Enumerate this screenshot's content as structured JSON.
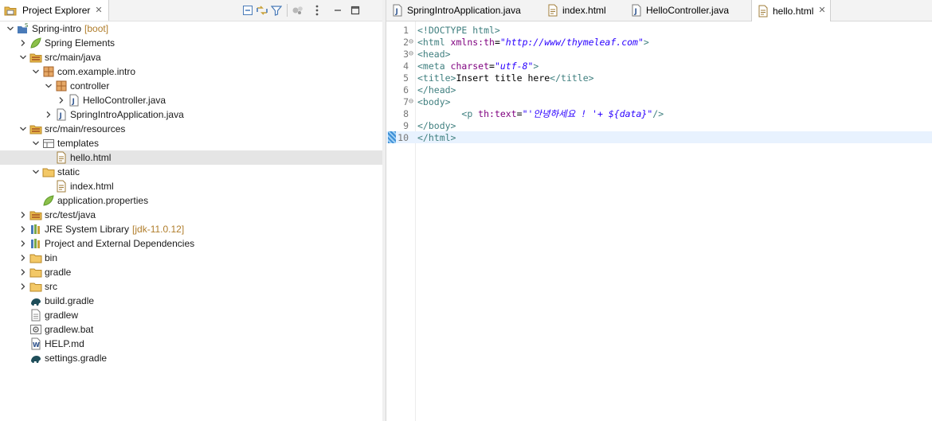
{
  "explorer": {
    "title": "Project Explorer",
    "tree": [
      {
        "label": "Spring-intro",
        "deco": "[boot]",
        "depth": 0,
        "twisty": "open",
        "icon": "boot-project-icon"
      },
      {
        "label": "Spring Elements",
        "depth": 1,
        "twisty": "closed",
        "icon": "spring-leaf-icon"
      },
      {
        "label": "src/main/java",
        "depth": 1,
        "twisty": "open",
        "icon": "source-folder-icon"
      },
      {
        "label": "com.example.intro",
        "depth": 2,
        "twisty": "open",
        "icon": "package-icon"
      },
      {
        "label": "controller",
        "depth": 3,
        "twisty": "open",
        "icon": "package-icon"
      },
      {
        "label": "HelloController.java",
        "depth": 4,
        "twisty": "closed",
        "icon": "java-file-icon"
      },
      {
        "label": "SpringIntroApplication.java",
        "depth": 3,
        "twisty": "closed",
        "icon": "java-file-icon"
      },
      {
        "label": "src/main/resources",
        "depth": 1,
        "twisty": "open",
        "icon": "source-folder-icon"
      },
      {
        "label": "templates",
        "depth": 2,
        "twisty": "open",
        "icon": "templates-folder-icon"
      },
      {
        "label": "hello.html",
        "depth": 3,
        "twisty": "none",
        "icon": "html-file-icon",
        "selected": true
      },
      {
        "label": "static",
        "depth": 2,
        "twisty": "open",
        "icon": "folder-icon"
      },
      {
        "label": "index.html",
        "depth": 3,
        "twisty": "none",
        "icon": "html-file-icon"
      },
      {
        "label": "application.properties",
        "depth": 2,
        "twisty": "none",
        "icon": "spring-leaf-icon"
      },
      {
        "label": "src/test/java",
        "depth": 1,
        "twisty": "closed",
        "icon": "source-folder-icon"
      },
      {
        "label": "JRE System Library",
        "deco": "[jdk-11.0.12]",
        "depth": 1,
        "twisty": "closed",
        "icon": "library-icon"
      },
      {
        "label": "Project and External Dependencies",
        "depth": 1,
        "twisty": "closed",
        "icon": "library-icon"
      },
      {
        "label": "bin",
        "depth": 1,
        "twisty": "closed",
        "icon": "folder-icon"
      },
      {
        "label": "gradle",
        "depth": 1,
        "twisty": "closed",
        "icon": "folder-icon"
      },
      {
        "label": "src",
        "depth": 1,
        "twisty": "closed",
        "icon": "folder-icon"
      },
      {
        "label": "build.gradle",
        "depth": 1,
        "twisty": "none",
        "icon": "gradle-icon"
      },
      {
        "label": "gradlew",
        "depth": 1,
        "twisty": "none",
        "icon": "text-file-icon"
      },
      {
        "label": "gradlew.bat",
        "depth": 1,
        "twisty": "none",
        "icon": "bat-file-icon"
      },
      {
        "label": "HELP.md",
        "depth": 1,
        "twisty": "none",
        "icon": "markdown-file-icon"
      },
      {
        "label": "settings.gradle",
        "depth": 1,
        "twisty": "none",
        "icon": "gradle-icon"
      }
    ]
  },
  "editor": {
    "tabs": [
      {
        "label": "SpringIntroApplication.java",
        "icon": "java-file-icon",
        "active": false
      },
      {
        "label": "index.html",
        "icon": "html-file-icon",
        "active": false
      },
      {
        "label": "HelloController.java",
        "icon": "java-file-icon",
        "active": false
      },
      {
        "label": "hello.html",
        "icon": "html-file-icon",
        "active": true
      }
    ],
    "lines": [
      {
        "n": "1",
        "fold": "",
        "parts": [
          [
            "tag",
            "<!DOCTYPE html>"
          ]
        ]
      },
      {
        "n": "2",
        "fold": "⊖",
        "parts": [
          [
            "tag",
            "<html "
          ],
          [
            "attr",
            "xmlns:th"
          ],
          [
            "plain",
            "="
          ],
          [
            "val",
            "\"http://www/thymeleaf.com\""
          ],
          [
            "tag",
            ">"
          ]
        ]
      },
      {
        "n": "3",
        "fold": "⊖",
        "parts": [
          [
            "tag",
            "<head>"
          ]
        ]
      },
      {
        "n": "4",
        "fold": "",
        "parts": [
          [
            "tag",
            "<meta "
          ],
          [
            "attr",
            "charset"
          ],
          [
            "plain",
            "="
          ],
          [
            "val",
            "\"utf-8\""
          ],
          [
            "tag",
            ">"
          ]
        ]
      },
      {
        "n": "5",
        "fold": "",
        "parts": [
          [
            "tag",
            "<title>"
          ],
          [
            "plain",
            "Insert title here"
          ],
          [
            "tag",
            "</title>"
          ]
        ]
      },
      {
        "n": "6",
        "fold": "",
        "parts": [
          [
            "tag",
            "</head>"
          ]
        ]
      },
      {
        "n": "7",
        "fold": "⊖",
        "parts": [
          [
            "tag",
            "<body>"
          ]
        ]
      },
      {
        "n": "8",
        "fold": "",
        "parts": [
          [
            "plain",
            "        "
          ],
          [
            "tag",
            "<p "
          ],
          [
            "attr",
            "th:text"
          ],
          [
            "plain",
            "="
          ],
          [
            "val",
            "\"'안녕하세요 ! '+ ${data}\""
          ],
          [
            "tag",
            "/>"
          ]
        ]
      },
      {
        "n": "9",
        "fold": "",
        "parts": [
          [
            "tag",
            "</body>"
          ]
        ]
      },
      {
        "n": "10",
        "fold": "",
        "parts": [
          [
            "tag",
            "</html>"
          ]
        ],
        "current": true
      }
    ]
  },
  "colors": {
    "tag": "#3f7f7f",
    "attr": "#7f007f",
    "value": "#2a00ff",
    "selection": "#e5e5e5",
    "current_line": "#e8f2fe"
  }
}
